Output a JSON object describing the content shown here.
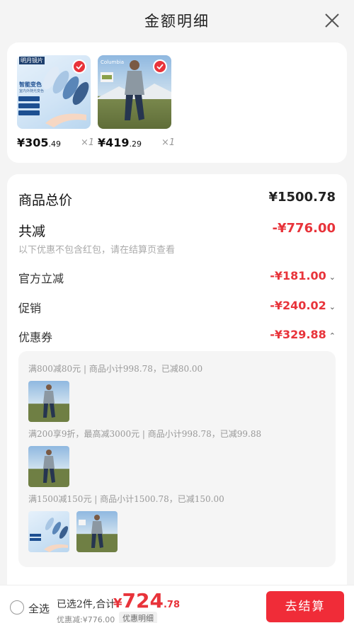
{
  "header": {
    "title": "金额明细"
  },
  "products": [
    {
      "price_int": "¥305",
      "price_dec": ".49",
      "qty": "×1",
      "icon": "lens-product-image",
      "img_texts": [
        "明月镜片",
        "智能变色",
        "室内外随光变色"
      ]
    },
    {
      "price_int": "¥419",
      "price_dec": ".29",
      "qty": "×1",
      "icon": "jacket-product-image",
      "brand": "Columbia"
    }
  ],
  "summary": {
    "total_label": "商品总价",
    "total_value": "¥1500.78",
    "reduce_label": "共减",
    "reduce_value": "-¥776.00",
    "reduce_note": "以下优惠不包含红包，请在结算页查看",
    "official_label": "官方立减",
    "official_value": "-¥181.00",
    "promo_label": "促销",
    "promo_value": "-¥240.02",
    "coupon_label": "优惠券",
    "coupon_value": "-¥329.88"
  },
  "coupons": [
    {
      "text": "满800减80元 | 商品小计998.78，已减80.00"
    },
    {
      "text": "满200享9折，最高减3000元 | 商品小计998.78，已减99.88"
    },
    {
      "text": "满1500减150元 | 商品小计1500.78，已减150.00"
    }
  ],
  "bottom": {
    "select_all": "全选",
    "selected_text": "已选2件,合计:",
    "total_sym": "¥",
    "total_int": "724",
    "total_dec": ".78",
    "discount_text": "优惠减:¥776.00",
    "detail_link": "优惠明细",
    "checkout": "去结算"
  },
  "colors": {
    "accent": "#e8333a",
    "checkout_bg": "#f02c38"
  }
}
